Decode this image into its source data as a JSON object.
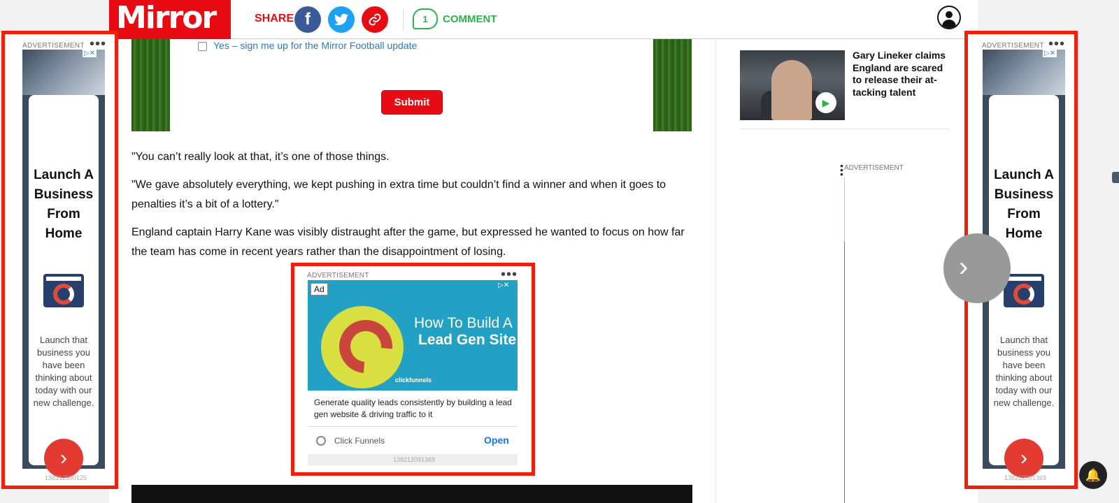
{
  "header": {
    "logo": "Mirror",
    "share_label": "SHARE",
    "comment_count": "1",
    "comment_label": "COMMENT"
  },
  "newsletter": {
    "checkbox_label": "Yes – sign me up for the Mirror Football update",
    "submit_label": "Submit"
  },
  "article": {
    "paragraphs": [
      "\"You can’t really look at that, it’s one of those things.",
      "\"We gave absolutely everything, we kept pushing in extra time but couldn’t find a winner and when it goes to penalties it’s a bit of a lottery.\"",
      "England captain Harry Kane was visibly distraught after the game, but expressed he wanted to focus on how far the team has come in recent years rather than the disappointment of losing."
    ]
  },
  "ad_left": {
    "label": "ADVERTISEMENT",
    "title": "Launch A Business From Home",
    "description": "Launch that business you have been thinking about today with our new challenge.",
    "id": "138312580125"
  },
  "ad_right": {
    "label": "ADVERTISEMENT",
    "title": "Launch A Business From Home",
    "description": "Launch that business you have been thinking about today with our new challenge.",
    "id": "138212091369"
  },
  "ad_mid": {
    "label": "ADVERTISEMENT",
    "badge": "Ad",
    "headline_1": "How To Build A",
    "headline_2": "Lead Gen Site",
    "brand": "clickfunnels",
    "description": "Generate quality leads consistently by building a lead gen website & driving traffic to it",
    "advertiser": "Click Funnels",
    "cta": "Open",
    "id": "138212091369"
  },
  "right_column": {
    "video_title": "Gary Lineker claims England are scared to release their at-tacking talent",
    "ad_label": "ADVERTISEMENT"
  },
  "colors": {
    "brand_red": "#e80b13",
    "ad_highlight": "#f0200c",
    "comment_green": "#2bb24c"
  }
}
